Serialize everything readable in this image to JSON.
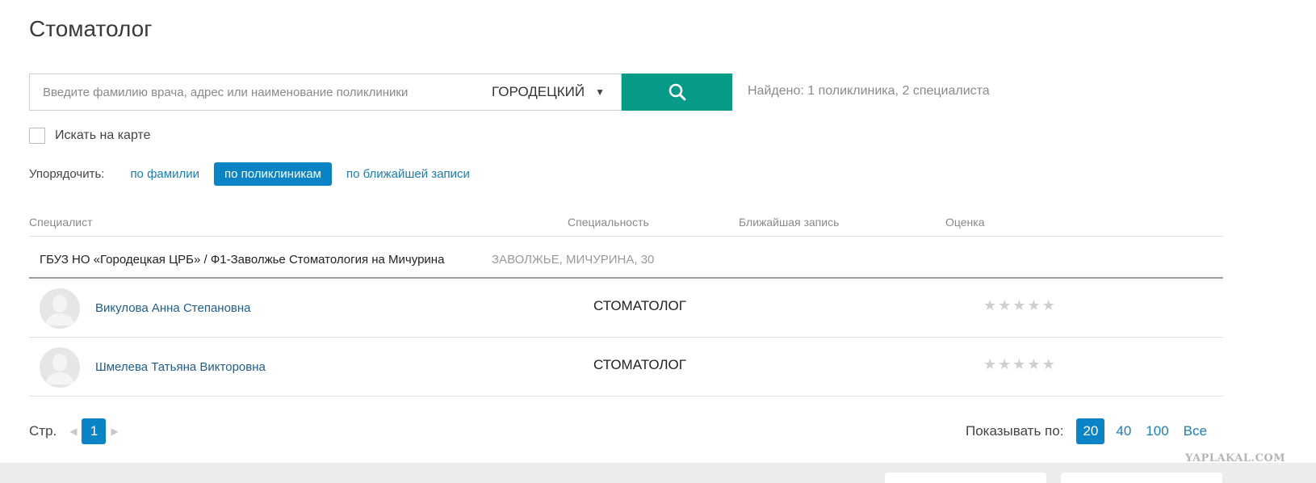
{
  "page": {
    "title": "Стоматолог"
  },
  "search": {
    "placeholder": "Введите фамилию врача, адрес или наименование поликлиники",
    "value": "",
    "city": "ГОРОДЕЦКИЙ",
    "found_text": "Найдено: 1 поликлиника, 2 специалиста"
  },
  "map_search": {
    "label": "Искать на карте",
    "checked": false
  },
  "sort": {
    "label": "Упорядочить:",
    "options": [
      "по фамилии",
      "по поликлиникам",
      "по ближайшей записи"
    ],
    "active": "по поликлиникам"
  },
  "table": {
    "headers": {
      "specialist": "Специалист",
      "specialty": "Специальность",
      "nearest": "Ближайшая запись",
      "rating": "Оценка"
    },
    "clinic": {
      "name": "ГБУЗ НО «Городецкая ЦРБ» / Ф1-Заволжье Стоматология на Мичурина",
      "address": "ЗАВОЛЖЬЕ, МИЧУРИНА, 30"
    },
    "doctors": [
      {
        "name": "Викулова Анна Степановна",
        "specialty": "СТОМАТОЛОГ",
        "rating": 0,
        "rating_max": 5
      },
      {
        "name": "Шмелева Татьяна Викторовна",
        "specialty": "СТОМАТОЛОГ",
        "rating": 0,
        "rating_max": 5
      }
    ]
  },
  "pagination": {
    "label": "Стр.",
    "current_page": "1"
  },
  "per_page": {
    "label": "Показывать по:",
    "options": [
      "20",
      "40",
      "100",
      "Все"
    ],
    "active": "20"
  },
  "watermark": "YAPLAKAL.COM",
  "colors": {
    "accent_green": "#059b87",
    "accent_blue": "#0b84c6",
    "link_blue": "#1a7fb5",
    "doctor_link": "#1f5e8c",
    "star_empty": "#cfcfcf"
  },
  "icons": {
    "search_button": "search-icon",
    "city_dropdown": "caret-down-icon",
    "avatar": "user-silhouette-icon",
    "rating": "star-icon",
    "pager_prev": "triangle-left-icon",
    "pager_next": "triangle-right-icon"
  }
}
